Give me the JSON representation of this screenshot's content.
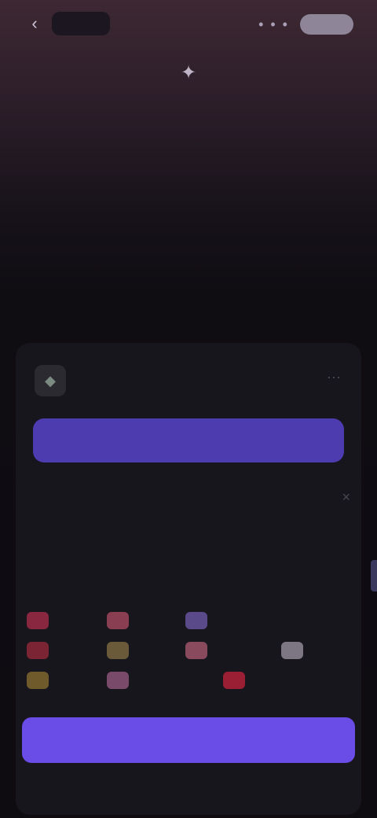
{
  "topbar": {
    "back_icon": "chevron-left-icon",
    "back_glyph": "‹",
    "more_glyph": "• • •"
  },
  "hero": {
    "icon": "spark-icon",
    "icon_glyph": "✦",
    "title": "",
    "subtitle": ""
  },
  "mid_caption": "",
  "section_label": "",
  "account": {
    "avatar_icon": "wallet-icon",
    "avatar_glyph": "◆",
    "name": "",
    "tag": "",
    "more_glyph": "⋯"
  },
  "primary_button": {
    "label": ""
  },
  "secondary_link": "",
  "info": {
    "title": "",
    "close_glyph": "×",
    "text": ""
  },
  "payment": {
    "label": "",
    "methods": [
      {
        "name": "",
        "color": "#8a2740"
      },
      {
        "name": "",
        "color": "#8a3e52"
      },
      {
        "name": "",
        "color": "#5a4a8a"
      },
      {
        "name": "",
        "color": "#7a2434"
      },
      {
        "name": "",
        "color": "#6b5a3a"
      },
      {
        "name": "",
        "color": "#8a4a5e"
      },
      {
        "name": "",
        "color": "#cfc9d6"
      },
      {
        "name": "",
        "color": "#6e5a2a"
      },
      {
        "name": "",
        "color": "#7a4a6a"
      },
      {
        "name": "",
        "color": "#9a1e34"
      }
    ]
  },
  "cta_button": {
    "label": ""
  },
  "colors": {
    "accent": "#6a4ce6",
    "accent_dark": "#4d3bb0",
    "background": "#0e0c11",
    "card": "#18161d"
  }
}
